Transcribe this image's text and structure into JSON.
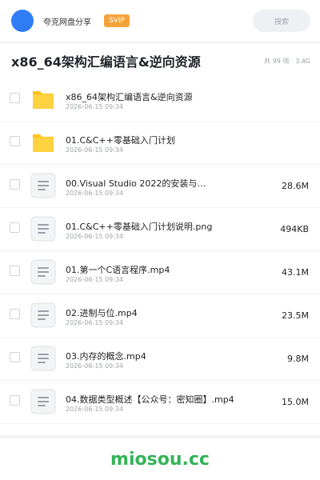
{
  "header": {
    "app_name": "夸克网盘分享",
    "badge": "SVIP",
    "search_label": "搜索"
  },
  "folder": {
    "title": "x86_64架构汇编语言&逆向资源",
    "meta": "共 99 项 · 3.4G"
  },
  "colors": {
    "accent": "#2f7cf6",
    "svip": "#f6a33a",
    "folder": "#ffd23f",
    "watermark": "#33b357"
  },
  "files": [
    {
      "icon": "folder-icon",
      "type": "folder",
      "name": "x86_64架构汇编语言&逆向资源",
      "date": "2026-06-15 09:34",
      "size": ""
    },
    {
      "icon": "folder-icon",
      "type": "folder",
      "name": "01.C&C++零基础入门计划",
      "date": "2026-06-15 09:34",
      "size": ""
    },
    {
      "icon": "document-icon",
      "type": "file",
      "name": "00.Visual Studio 2022的安装与…",
      "date": "2026-06-15 09:34",
      "size": "28.6M"
    },
    {
      "icon": "document-icon",
      "type": "file",
      "name": "01.C&C++零基础入门计划说明.png",
      "date": "2026-06-15 09:34",
      "size": "494KB"
    },
    {
      "icon": "document-icon",
      "type": "file",
      "name": "01.第一个C语言程序.mp4",
      "date": "2026-06-15 09:34",
      "size": "43.1M"
    },
    {
      "icon": "document-icon",
      "type": "file",
      "name": "02.进制与位.mp4",
      "date": "2026-06-15 09:34",
      "size": "23.5M"
    },
    {
      "icon": "document-icon",
      "type": "file",
      "name": "03.内存的概念.mp4",
      "date": "2026-06-15 09:34",
      "size": "9.8M"
    },
    {
      "icon": "document-icon",
      "type": "file",
      "name": "04.数据类型概述【公众号：密知圈】.mp4",
      "date": "2026-06-15 09:34",
      "size": "15.0M"
    }
  ],
  "watermark": "miosou.cc"
}
